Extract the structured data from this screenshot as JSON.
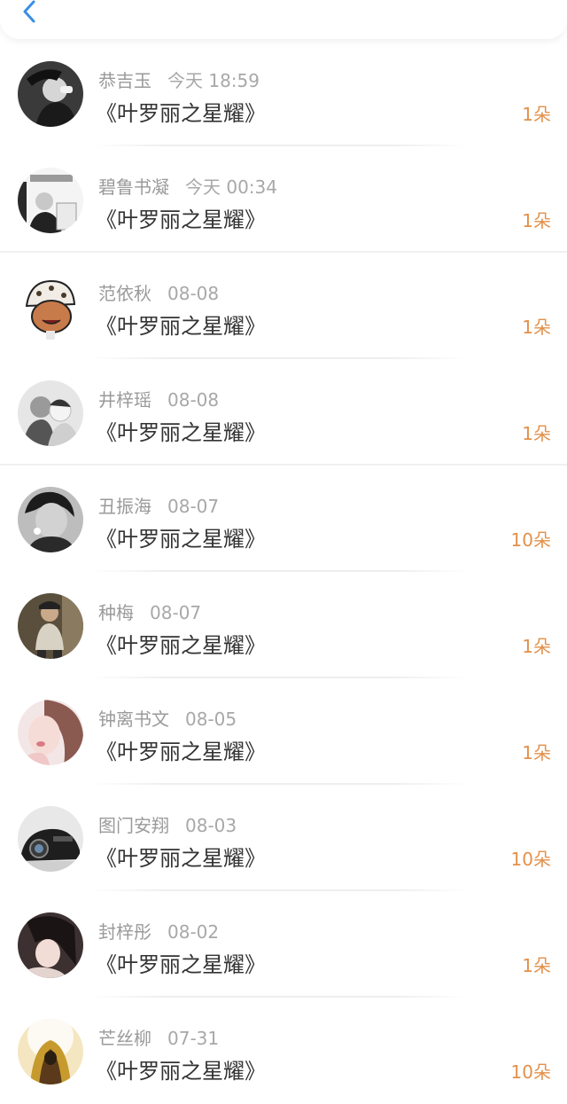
{
  "header": {
    "back_icon": "chevron-left-icon"
  },
  "colors": {
    "accent": "#3a8ee6",
    "amount": "#e3904a",
    "name": "#9a9a9a",
    "title": "#333333"
  },
  "records": [
    {
      "name": "恭吉玉",
      "time": "今天 18:59",
      "title": "《叶罗丽之星耀》",
      "amount": "1朵"
    },
    {
      "name": "碧鲁书凝",
      "time": "今天 00:34",
      "title": "《叶罗丽之星耀》",
      "amount": "1朵"
    },
    {
      "name": "范依秋",
      "time": "08-08",
      "title": "《叶罗丽之星耀》",
      "amount": "1朵"
    },
    {
      "name": "井梓瑶",
      "time": "08-08",
      "title": "《叶罗丽之星耀》",
      "amount": "1朵"
    },
    {
      "name": "丑振海",
      "time": "08-07",
      "title": "《叶罗丽之星耀》",
      "amount": "10朵"
    },
    {
      "name": "种梅",
      "time": "08-07",
      "title": "《叶罗丽之星耀》",
      "amount": "1朵"
    },
    {
      "name": "钟离书文",
      "time": "08-05",
      "title": "《叶罗丽之星耀》",
      "amount": "1朵"
    },
    {
      "name": "图门安翔",
      "time": "08-03",
      "title": "《叶罗丽之星耀》",
      "amount": "10朵"
    },
    {
      "name": "封梓彤",
      "time": "08-02",
      "title": "《叶罗丽之星耀》",
      "amount": "1朵"
    },
    {
      "name": "芒丝柳",
      "time": "07-31",
      "title": "《叶罗丽之星耀》",
      "amount": "10朵"
    }
  ]
}
